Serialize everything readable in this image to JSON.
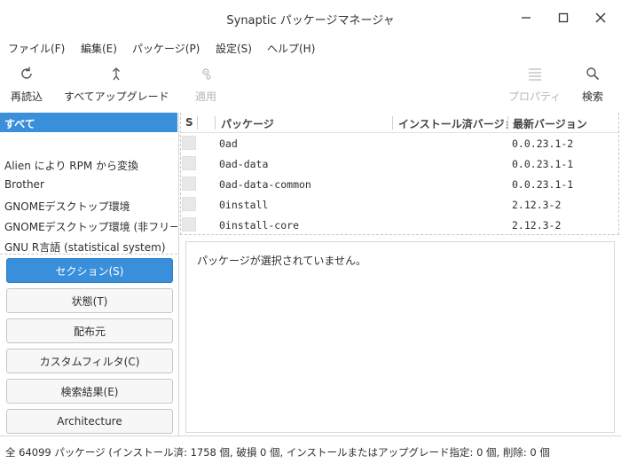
{
  "window": {
    "title": "Synaptic パッケージマネージャ"
  },
  "menu": [
    "ファイル(F)",
    "編集(E)",
    "パッケージ(P)",
    "設定(S)",
    "ヘルプ(H)"
  ],
  "toolbar": {
    "reload": "再読込",
    "upgrade_all": "すべてアップグレード",
    "apply": "適用",
    "properties": "プロパティ",
    "search": "検索"
  },
  "sections": {
    "selected": "すべて",
    "items": [
      "Alien により RPM から変換",
      "Brother",
      "GNOMEデスクトップ環境",
      "GNOMEデスクトップ環境 (非フリー)",
      "GNU R言語 (statistical system)"
    ]
  },
  "filter_buttons": [
    "セクション(S)",
    "状態(T)",
    "配布元",
    "カスタムフィルタ(C)",
    "検索結果(E)",
    "Architecture"
  ],
  "table": {
    "headers": {
      "s": "S",
      "package": "パッケージ",
      "installed": "インストール済バージョン",
      "latest": "最新バージョン"
    },
    "rows": [
      {
        "name": "0ad",
        "latest": "0.0.23.1-2"
      },
      {
        "name": "0ad-data",
        "latest": "0.0.23.1-1"
      },
      {
        "name": "0ad-data-common",
        "latest": "0.0.23.1-1"
      },
      {
        "name": "0install",
        "latest": "2.12.3-2"
      },
      {
        "name": "0install-core",
        "latest": "2.12.3-2"
      }
    ]
  },
  "description": {
    "text": "パッケージが選択されていません。"
  },
  "status": {
    "text": "全 64099 パッケージ (インストール済: 1758 個, 破損 0 個, インストールまたはアップグレード指定: 0 個, 削除: 0 個"
  }
}
